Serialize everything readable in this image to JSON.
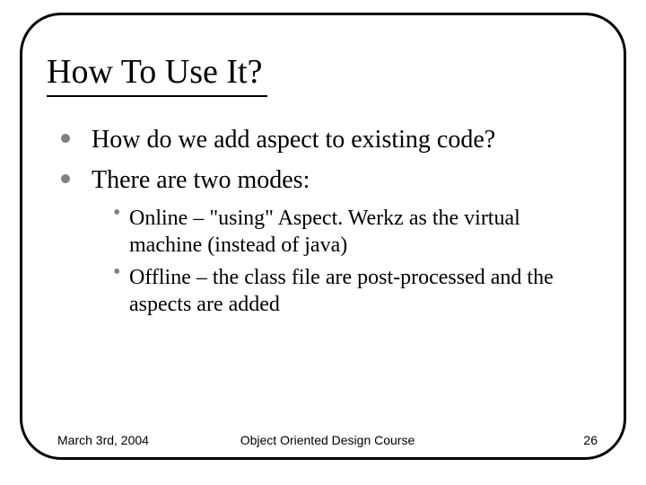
{
  "title": "How To Use It?",
  "bullets": {
    "b1": "How do we add aspect to existing code?",
    "b2": "There are two modes:"
  },
  "sub": {
    "s1": "Online – \"using\" Aspect. Werkz as the virtual machine (instead of java)",
    "s2": "Offline – the class file are post-processed and the aspects are added"
  },
  "footer": {
    "date": "March 3rd, 2004",
    "course": "Object Oriented Design Course",
    "page": "26"
  }
}
